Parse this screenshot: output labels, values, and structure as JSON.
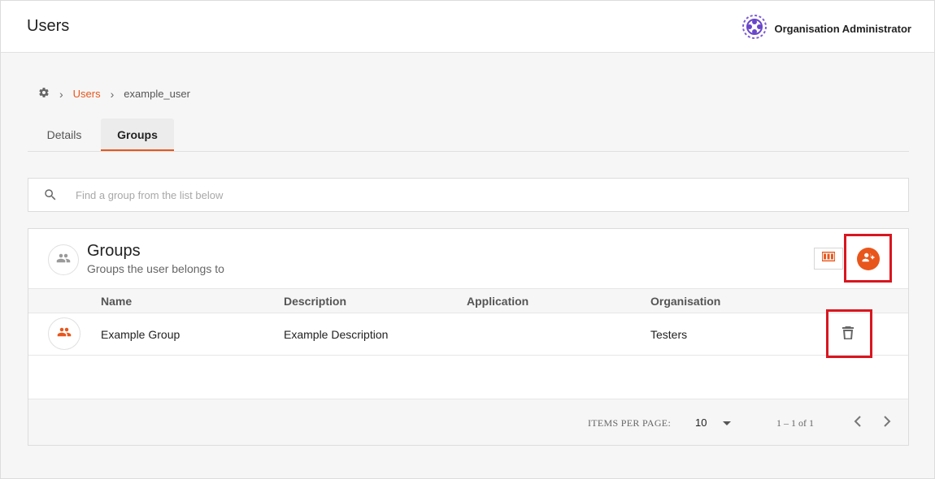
{
  "header": {
    "title": "Users",
    "org_label": "Organisation Administrator"
  },
  "breadcrumb": {
    "root_icon": "gear-icon",
    "items": [
      "Users",
      "example_user"
    ]
  },
  "tabs": [
    {
      "label": "Details",
      "active": false
    },
    {
      "label": "Groups",
      "active": true
    }
  ],
  "search": {
    "placeholder": "Find a group from the list below"
  },
  "groups_card": {
    "title": "Groups",
    "subtitle": "Groups the user belongs to",
    "columns": [
      "Name",
      "Description",
      "Application",
      "Organisation"
    ],
    "rows": [
      {
        "name": "Example Group",
        "description": "Example Description",
        "application": "",
        "organisation": "Testers"
      }
    ],
    "pagination": {
      "items_per_page_label": "ITEMS PER PAGE:",
      "items_per_page": "10",
      "range": "1 – 1 of 1"
    }
  },
  "colors": {
    "accent": "#e8561c",
    "highlight": "#d9161f"
  }
}
